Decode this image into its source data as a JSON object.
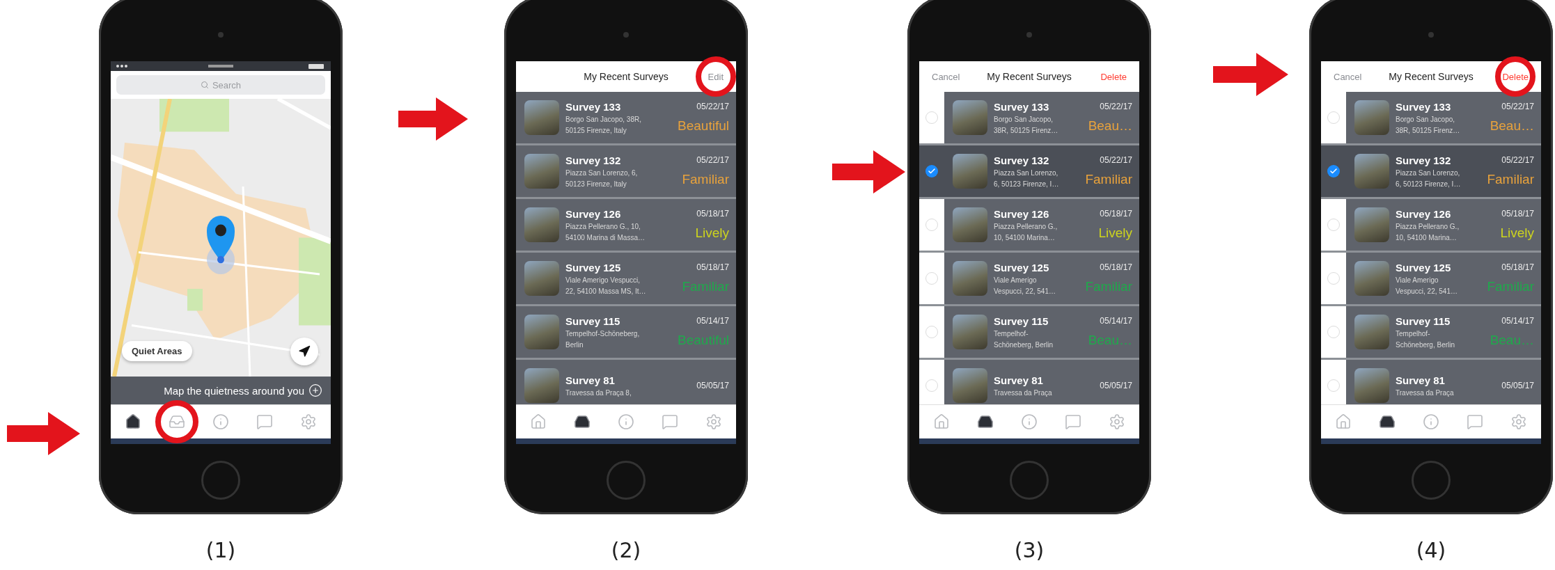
{
  "panels": [
    {
      "caption": "(1)",
      "screen": {
        "kind": "map",
        "search_placeholder": "Search",
        "filter_button": "Quiet Areas",
        "banner": "Map the quietness around you",
        "tabs": [
          {
            "selected": true,
            "highlighted": false
          },
          {
            "selected": false,
            "highlighted": true
          },
          {
            "selected": false,
            "highlighted": false
          },
          {
            "selected": false,
            "highlighted": false
          },
          {
            "selected": false,
            "highlighted": false
          }
        ]
      }
    },
    {
      "caption": "(2)",
      "screen": {
        "kind": "list",
        "edit_mode": false,
        "header": {
          "title": "My Recent Surveys",
          "right_button": {
            "label": "Edit",
            "kind": "plain",
            "highlighted": true
          }
        },
        "rows": [
          {
            "title": "Survey 133",
            "date": "05/22/17",
            "address": [
              "Borgo San Jacopo, 38R,",
              "50125 Firenze, Italy"
            ],
            "rating": "Beautiful",
            "color": "#e8a23c"
          },
          {
            "title": "Survey 132",
            "date": "05/22/17",
            "address": [
              "Piazza San Lorenzo, 6,",
              "50123 Firenze, Italy"
            ],
            "rating": "Familiar",
            "color": "#e8a23c"
          },
          {
            "title": "Survey 126",
            "date": "05/18/17",
            "address": [
              "Piazza Pellerano G., 10,",
              "54100 Marina di Massa…"
            ],
            "rating": "Lively",
            "color": "#cdd41e"
          },
          {
            "title": "Survey 125",
            "date": "05/18/17",
            "address": [
              "Viale Amerigo Vespucci,",
              "22, 54100 Massa MS, It…"
            ],
            "rating": "Familiar",
            "color": "#1faa4c"
          },
          {
            "title": "Survey 115",
            "date": "05/14/17",
            "address": [
              "Tempelhof-Schöneberg,",
              "Berlin"
            ],
            "rating": "Beautiful",
            "color": "#1faa4c"
          },
          {
            "title": "Survey 81",
            "date": "05/05/17",
            "address": [
              "Travessa da Praça 8,"
            ]
          }
        ],
        "tabs": [
          {
            "selected": false,
            "highlighted": false
          },
          {
            "selected": true,
            "highlighted": false
          },
          {
            "selected": false,
            "highlighted": false
          },
          {
            "selected": false,
            "highlighted": false
          },
          {
            "selected": false,
            "highlighted": false
          }
        ]
      }
    },
    {
      "caption": "(3)",
      "screen": {
        "kind": "list",
        "edit_mode": true,
        "header": {
          "left_button": "Cancel",
          "title": "My Recent Surveys",
          "right_button": {
            "label": "Delete",
            "kind": "destructive",
            "highlighted": false
          }
        },
        "rows": [
          {
            "title": "Survey 133",
            "date": "05/22/17",
            "address": [
              "Borgo San Jacopo,",
              "38R, 50125 Firenz…"
            ],
            "rating": "Beau…",
            "color": "#e8a23c",
            "selected": false
          },
          {
            "title": "Survey 132",
            "date": "05/22/17",
            "address": [
              "Piazza San Lorenzo,",
              "6, 50123 Firenze, I…"
            ],
            "rating": "Familiar",
            "color": "#e8a23c",
            "selected": true
          },
          {
            "title": "Survey 126",
            "date": "05/18/17",
            "address": [
              "Piazza Pellerano G.,",
              "10, 54100 Marina…"
            ],
            "rating": "Lively",
            "color": "#cdd41e",
            "selected": false
          },
          {
            "title": "Survey 125",
            "date": "05/18/17",
            "address": [
              "Viale Amerigo",
              "Vespucci, 22, 541…"
            ],
            "rating": "Familiar",
            "color": "#1faa4c",
            "selected": false
          },
          {
            "title": "Survey 115",
            "date": "05/14/17",
            "address": [
              "Tempelhof-",
              "Schöneberg, Berlin"
            ],
            "rating": "Beau…",
            "color": "#1faa4c",
            "selected": false
          },
          {
            "title": "Survey 81",
            "date": "05/05/17",
            "address": [
              "Travessa da Praça"
            ],
            "selected": false
          }
        ],
        "tabs": [
          {
            "selected": false,
            "highlighted": false
          },
          {
            "selected": true,
            "highlighted": false
          },
          {
            "selected": false,
            "highlighted": false
          },
          {
            "selected": false,
            "highlighted": false
          },
          {
            "selected": false,
            "highlighted": false
          }
        ]
      }
    },
    {
      "caption": "(4)",
      "screen": {
        "kind": "list",
        "edit_mode": true,
        "header": {
          "left_button": "Cancel",
          "title": "My Recent Surveys",
          "right_button": {
            "label": "Delete",
            "kind": "destructive",
            "highlighted": true
          }
        },
        "rows": [
          {
            "title": "Survey 133",
            "date": "05/22/17",
            "address": [
              "Borgo San Jacopo,",
              "38R, 50125 Firenz…"
            ],
            "rating": "Beau…",
            "color": "#e8a23c",
            "selected": false
          },
          {
            "title": "Survey 132",
            "date": "05/22/17",
            "address": [
              "Piazza San Lorenzo,",
              "6, 50123 Firenze, I…"
            ],
            "rating": "Familiar",
            "color": "#e8a23c",
            "selected": true
          },
          {
            "title": "Survey 126",
            "date": "05/18/17",
            "address": [
              "Piazza Pellerano G.,",
              "10, 54100 Marina…"
            ],
            "rating": "Lively",
            "color": "#cdd41e",
            "selected": false
          },
          {
            "title": "Survey 125",
            "date": "05/18/17",
            "address": [
              "Viale Amerigo",
              "Vespucci, 22, 541…"
            ],
            "rating": "Familiar",
            "color": "#1faa4c",
            "selected": false
          },
          {
            "title": "Survey 115",
            "date": "05/14/17",
            "address": [
              "Tempelhof-",
              "Schöneberg, Berlin"
            ],
            "rating": "Beau…",
            "color": "#1faa4c",
            "selected": false
          },
          {
            "title": "Survey 81",
            "date": "05/05/17",
            "address": [
              "Travessa da Praça"
            ],
            "selected": false
          }
        ],
        "tabs": [
          {
            "selected": false,
            "highlighted": false
          },
          {
            "selected": true,
            "highlighted": false
          },
          {
            "selected": false,
            "highlighted": false
          },
          {
            "selected": false,
            "highlighted": false
          },
          {
            "selected": false,
            "highlighted": false
          }
        ]
      }
    }
  ]
}
